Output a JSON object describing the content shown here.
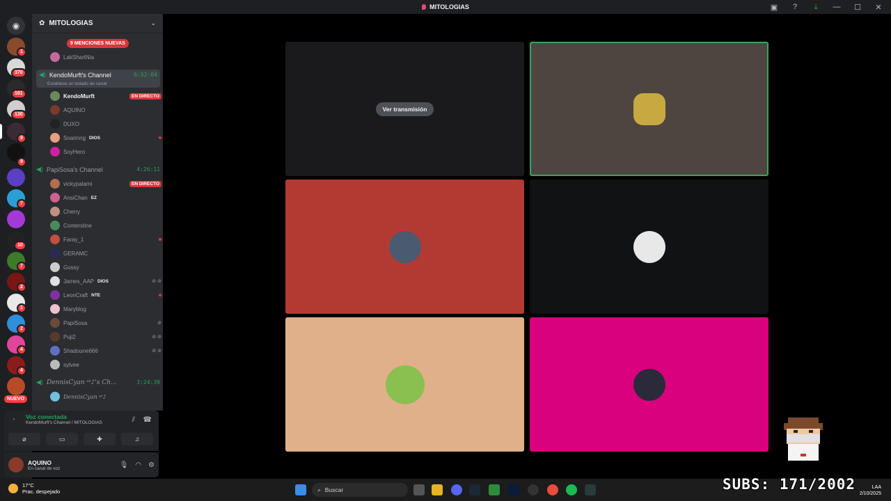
{
  "window": {
    "title": "MITOLOGIAS"
  },
  "server": {
    "name": "MITOLOGIAS",
    "mentions_banner": "9 MENCIONES NUEVAS",
    "top_user": "LakShartNia",
    "channels": [
      {
        "name": "KendoMurft's Channel",
        "time": "6:52:04",
        "status": "Establece un estado de canal",
        "members": [
          {
            "name": "KendoMurft",
            "live": "EN DIRECTO"
          },
          {
            "name": "AQUINO"
          },
          {
            "name": "DUXO"
          },
          {
            "name": "Soarinng",
            "tag": "DIOS"
          },
          {
            "name": "SoyHero"
          }
        ]
      },
      {
        "name": "PapiSosa's Channel",
        "time": "4:26:11",
        "members": [
          {
            "name": "vickypalami",
            "live": "EN DIRECTO"
          },
          {
            "name": "AnsiChan",
            "tag": "EZ"
          },
          {
            "name": "Cherry"
          },
          {
            "name": "Conterstine"
          },
          {
            "name": "Faray_1"
          },
          {
            "name": "GERAMC"
          },
          {
            "name": "Gussy"
          },
          {
            "name": "James_AAP",
            "tag": "DIOS"
          },
          {
            "name": "LeonCraft",
            "tag": "NTE"
          },
          {
            "name": "Maryblog"
          },
          {
            "name": "PapiSosa"
          },
          {
            "name": "Puji2"
          },
          {
            "name": "Shadoune666"
          },
          {
            "name": "sylvee"
          }
        ]
      },
      {
        "name": "DennisCyan ᶻᶻ♪'s Ch...",
        "time": "3:24:39",
        "members": [
          {
            "name": "DennisCyan ᶻᶻ♪"
          }
        ]
      }
    ]
  },
  "guild_badges": [
    "1",
    "370",
    "101",
    "130",
    "9",
    "9",
    "7",
    "10",
    "7",
    "2",
    "1",
    "2",
    "4",
    "4"
  ],
  "nuevo_label": "NUEVO",
  "voice": {
    "status": "Voz conectada",
    "location": "KendoMurft's Channel / MITOLOGIAS"
  },
  "user": {
    "name": "AQUINO",
    "status": "En canal de voz"
  },
  "stage": {
    "watch_label": "Ver transmisión"
  },
  "taskbar": {
    "weather_temp": "17°C",
    "weather_desc": "Prac. despejado",
    "search_label": "Buscar",
    "lang": "LAA",
    "date": "2/10/2025"
  },
  "overlay": {
    "subs": "SUBS: 171/2002"
  },
  "colors": {
    "tile_stream": "#1a1a1c",
    "tile_gray": "#4e4541",
    "tile_red": "#b33a33",
    "tile_dark": "#111214",
    "tile_peach": "#e0b08a",
    "tile_pink": "#d9017e",
    "speaking_border": "#3ba55d"
  }
}
